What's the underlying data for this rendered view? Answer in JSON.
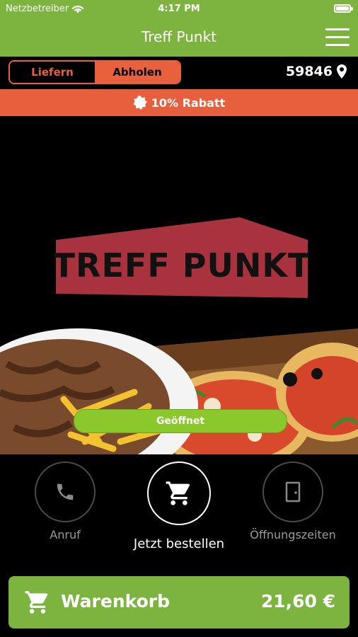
{
  "status": {
    "carrier": "Netzbetreiber",
    "time": "4:17 PM"
  },
  "nav": {
    "title": "Treff Punkt"
  },
  "mode": {
    "deliver": "Liefern",
    "pickup": "Abholen",
    "selected": "Abholen"
  },
  "location": {
    "zip": "59846"
  },
  "promo": {
    "text": "10% Rabatt"
  },
  "hero": {
    "logo_text": "TREFF PUNKT",
    "status_button": "Geöffnet"
  },
  "actions": {
    "call": "Anruf",
    "order": "Jetzt bestellen",
    "hours": "Öffnungszeiten"
  },
  "cart": {
    "label": "Warenkorb",
    "total": "21,60 €"
  },
  "colors": {
    "green": "#7db33f",
    "orange": "#e85f3e",
    "logo_red": "#a8323e",
    "open_green": "#8ac82c"
  }
}
